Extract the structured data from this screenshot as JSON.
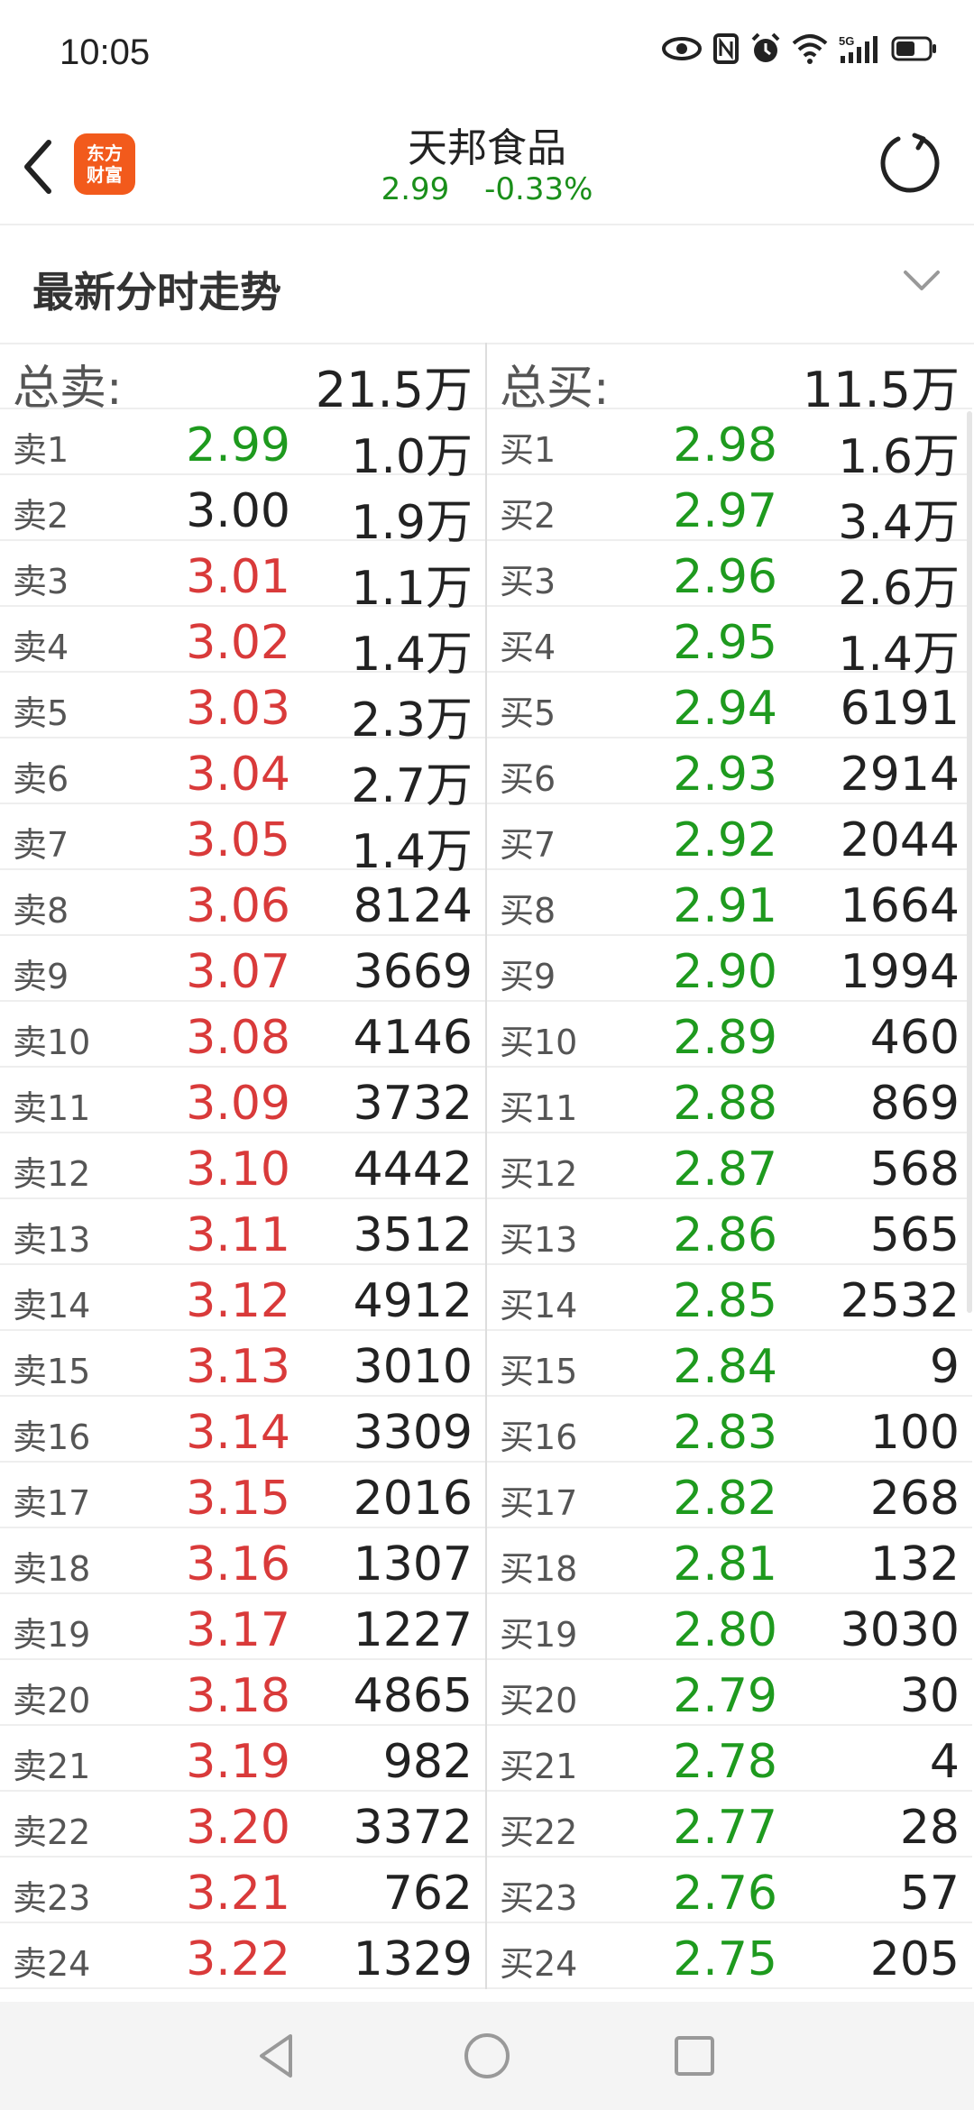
{
  "status_bar": {
    "time": "10:05"
  },
  "header": {
    "title": "天邦食品",
    "price": "2.99",
    "change_pct": "-0.33%",
    "logo_text_line1": "东方",
    "logo_text_line2": "财富"
  },
  "section": {
    "label": "最新分时走势"
  },
  "sell": {
    "total_label": "总卖:",
    "total_value": "21.5万",
    "rows": [
      {
        "level": "卖1",
        "price": "2.99",
        "vol": "1.0万",
        "color": "green"
      },
      {
        "level": "卖2",
        "price": "3.00",
        "vol": "1.9万",
        "color": "neutral"
      },
      {
        "level": "卖3",
        "price": "3.01",
        "vol": "1.1万",
        "color": "red"
      },
      {
        "level": "卖4",
        "price": "3.02",
        "vol": "1.4万",
        "color": "red"
      },
      {
        "level": "卖5",
        "price": "3.03",
        "vol": "2.3万",
        "color": "red"
      },
      {
        "level": "卖6",
        "price": "3.04",
        "vol": "2.7万",
        "color": "red"
      },
      {
        "level": "卖7",
        "price": "3.05",
        "vol": "1.4万",
        "color": "red"
      },
      {
        "level": "卖8",
        "price": "3.06",
        "vol": "8124",
        "color": "red"
      },
      {
        "level": "卖9",
        "price": "3.07",
        "vol": "3669",
        "color": "red"
      },
      {
        "level": "卖10",
        "price": "3.08",
        "vol": "4146",
        "color": "red"
      },
      {
        "level": "卖11",
        "price": "3.09",
        "vol": "3732",
        "color": "red"
      },
      {
        "level": "卖12",
        "price": "3.10",
        "vol": "4442",
        "color": "red"
      },
      {
        "level": "卖13",
        "price": "3.11",
        "vol": "3512",
        "color": "red"
      },
      {
        "level": "卖14",
        "price": "3.12",
        "vol": "4912",
        "color": "red"
      },
      {
        "level": "卖15",
        "price": "3.13",
        "vol": "3010",
        "color": "red"
      },
      {
        "level": "卖16",
        "price": "3.14",
        "vol": "3309",
        "color": "red"
      },
      {
        "level": "卖17",
        "price": "3.15",
        "vol": "2016",
        "color": "red"
      },
      {
        "level": "卖18",
        "price": "3.16",
        "vol": "1307",
        "color": "red"
      },
      {
        "level": "卖19",
        "price": "3.17",
        "vol": "1227",
        "color": "red"
      },
      {
        "level": "卖20",
        "price": "3.18",
        "vol": "4865",
        "color": "red"
      },
      {
        "level": "卖21",
        "price": "3.19",
        "vol": "982",
        "color": "red"
      },
      {
        "level": "卖22",
        "price": "3.20",
        "vol": "3372",
        "color": "red"
      },
      {
        "level": "卖23",
        "price": "3.21",
        "vol": "762",
        "color": "red"
      },
      {
        "level": "卖24",
        "price": "3.22",
        "vol": "1329",
        "color": "red"
      }
    ]
  },
  "buy": {
    "total_label": "总买:",
    "total_value": "11.5万",
    "rows": [
      {
        "level": "买1",
        "price": "2.98",
        "vol": "1.6万",
        "color": "green"
      },
      {
        "level": "买2",
        "price": "2.97",
        "vol": "3.4万",
        "color": "green"
      },
      {
        "level": "买3",
        "price": "2.96",
        "vol": "2.6万",
        "color": "green"
      },
      {
        "level": "买4",
        "price": "2.95",
        "vol": "1.4万",
        "color": "green"
      },
      {
        "level": "买5",
        "price": "2.94",
        "vol": "6191",
        "color": "green"
      },
      {
        "level": "买6",
        "price": "2.93",
        "vol": "2914",
        "color": "green"
      },
      {
        "level": "买7",
        "price": "2.92",
        "vol": "2044",
        "color": "green"
      },
      {
        "level": "买8",
        "price": "2.91",
        "vol": "1664",
        "color": "green"
      },
      {
        "level": "买9",
        "price": "2.90",
        "vol": "1994",
        "color": "green"
      },
      {
        "level": "买10",
        "price": "2.89",
        "vol": "460",
        "color": "green"
      },
      {
        "level": "买11",
        "price": "2.88",
        "vol": "869",
        "color": "green"
      },
      {
        "level": "买12",
        "price": "2.87",
        "vol": "568",
        "color": "green"
      },
      {
        "level": "买13",
        "price": "2.86",
        "vol": "565",
        "color": "green"
      },
      {
        "level": "买14",
        "price": "2.85",
        "vol": "2532",
        "color": "green"
      },
      {
        "level": "买15",
        "price": "2.84",
        "vol": "9",
        "color": "green"
      },
      {
        "level": "买16",
        "price": "2.83",
        "vol": "100",
        "color": "green"
      },
      {
        "level": "买17",
        "price": "2.82",
        "vol": "268",
        "color": "green"
      },
      {
        "level": "买18",
        "price": "2.81",
        "vol": "132",
        "color": "green"
      },
      {
        "level": "买19",
        "price": "2.80",
        "vol": "3030",
        "color": "green"
      },
      {
        "level": "买20",
        "price": "2.79",
        "vol": "30",
        "color": "green"
      },
      {
        "level": "买21",
        "price": "2.78",
        "vol": "4",
        "color": "green"
      },
      {
        "level": "买22",
        "price": "2.77",
        "vol": "28",
        "color": "green"
      },
      {
        "level": "买23",
        "price": "2.76",
        "vol": "57",
        "color": "green"
      },
      {
        "level": "买24",
        "price": "2.75",
        "vol": "205",
        "color": "green"
      }
    ]
  },
  "colors": {
    "up": "#d93a3a",
    "down": "#1e9a1e",
    "brand": "#f25a1c"
  }
}
